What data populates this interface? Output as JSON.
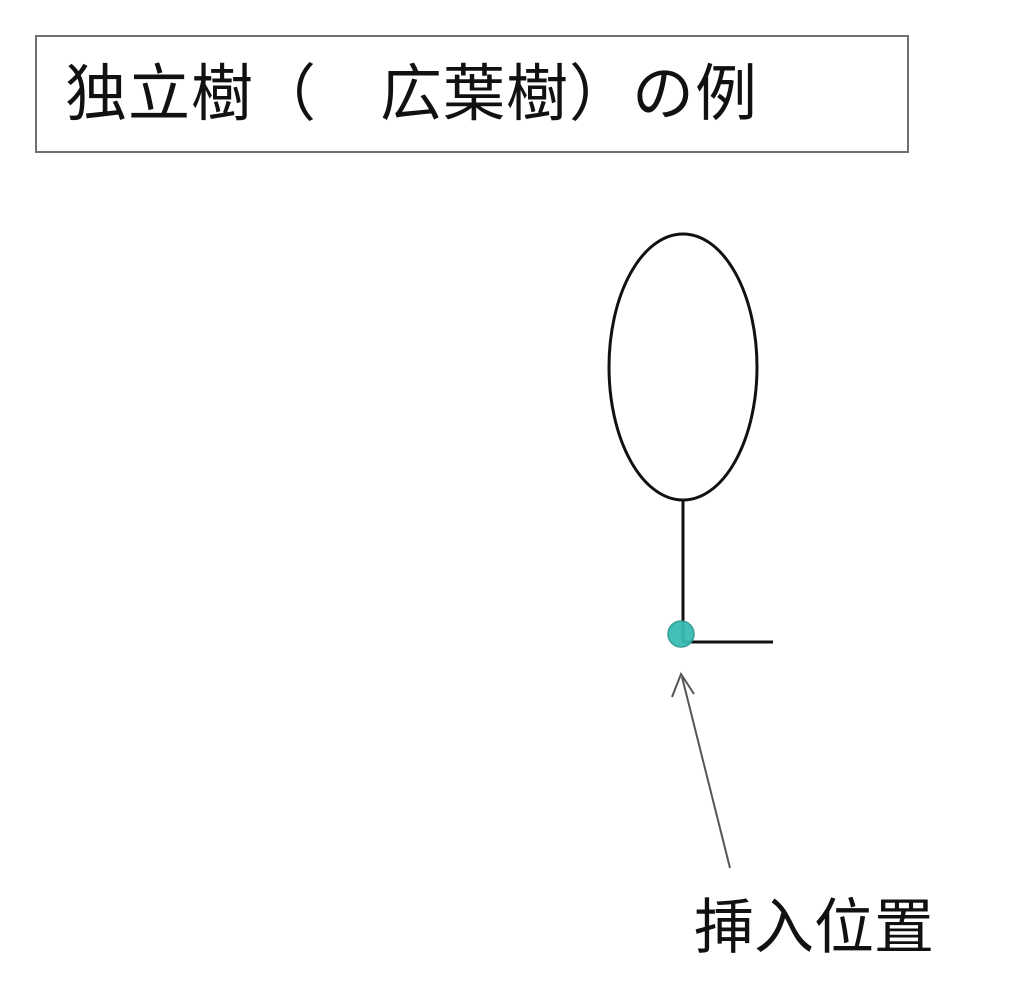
{
  "title": "独立樹（　広葉樹）の例",
  "callout": {
    "label": "挿入位置"
  },
  "colors": {
    "line": "#111111",
    "arrow": "#555555",
    "marker": "#3bbcb3",
    "box_border": "#6f6f6f"
  },
  "icons": {
    "tree": "broadleaf-tree-icon",
    "marker": "insertion-point-marker"
  }
}
